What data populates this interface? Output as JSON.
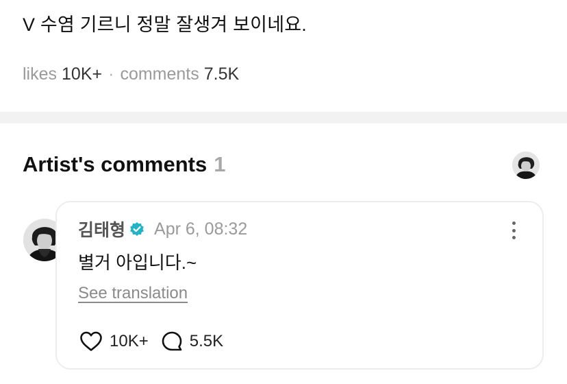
{
  "post": {
    "text": "V 수염 기르니 정말 잘생겨 보이네요.",
    "likes_label": "likes",
    "likes_count": "10K+",
    "separator": "·",
    "comments_label": "comments",
    "comments_count": "7.5K"
  },
  "artist_comments": {
    "title": "Artist's comments",
    "count": "1",
    "header_avatar_icon": "artist-avatar-icon"
  },
  "comment": {
    "author": "김태형",
    "verified_icon": "verified-badge-icon",
    "verified_color": "#23b3c4",
    "timestamp": "Apr 6, 08:32",
    "text": "별거 아입니다.~",
    "see_translation": "See translation",
    "like_icon": "heart-icon",
    "like_count": "10K+",
    "reply_icon": "comment-bubble-icon",
    "reply_count": "5.5K",
    "more_icon": "more-vertical-icon"
  }
}
